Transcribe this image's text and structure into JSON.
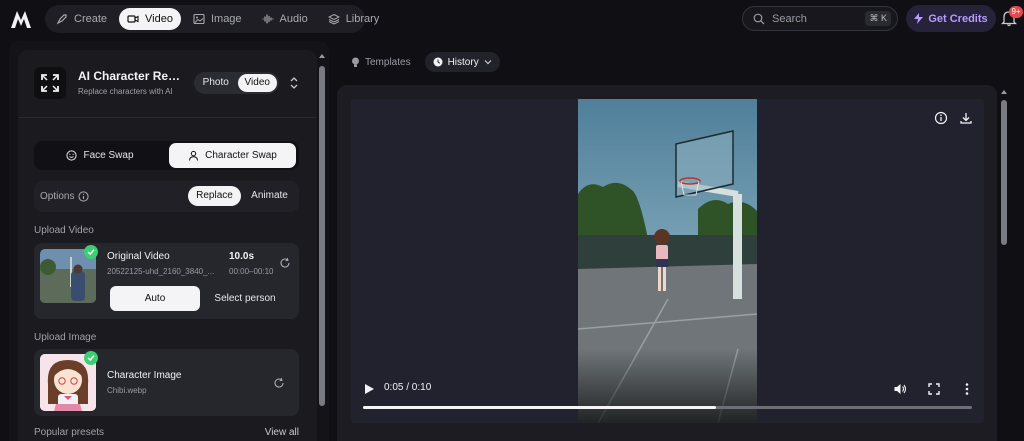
{
  "nav": {
    "items": [
      {
        "label": "Create",
        "icon": "rocket-icon",
        "active": false
      },
      {
        "label": "Video",
        "icon": "video-icon",
        "active": true
      },
      {
        "label": "Image",
        "icon": "image-icon",
        "active": false
      },
      {
        "label": "Audio",
        "icon": "audio-wave-icon",
        "active": false
      },
      {
        "label": "Library",
        "icon": "stack-icon",
        "active": false
      }
    ]
  },
  "search": {
    "placeholder": "Search",
    "shortcut": "⌘ K"
  },
  "credits": {
    "label": "Get Credits"
  },
  "notifications": {
    "badge": "9+"
  },
  "tool": {
    "title": "AI Character Rep...",
    "subtitle": "Replace characters with AI",
    "modes": [
      "Photo",
      "Video"
    ],
    "active_mode": "Video"
  },
  "swap": {
    "face_label": "Face Swap",
    "character_label": "Character Swap",
    "active": "Character Swap"
  },
  "options": {
    "label": "Options",
    "modes": [
      "Replace",
      "Animate"
    ],
    "active": "Replace"
  },
  "upload_video": {
    "section_label": "Upload Video",
    "title": "Original Video",
    "filename": "20522125-uhd_2160_3840_...",
    "duration": "10.0s",
    "range": "00:00–00:10",
    "auto_label": "Auto",
    "select_label": "Select person"
  },
  "upload_image": {
    "section_label": "Upload Image",
    "title": "Character Image",
    "filename": "Chibi.webp"
  },
  "presets": {
    "label": "Popular presets",
    "view_all": "View all"
  },
  "tabs": [
    {
      "label": "Templates",
      "icon": "bulb-icon",
      "active": false
    },
    {
      "label": "History",
      "icon": "clock-icon",
      "active": true
    }
  ],
  "player": {
    "time": "0:05 / 0:10",
    "progress": 0.58
  },
  "colors": {
    "accent": "#b69cff",
    "success": "#3ccf72",
    "badge": "#e5484d"
  }
}
